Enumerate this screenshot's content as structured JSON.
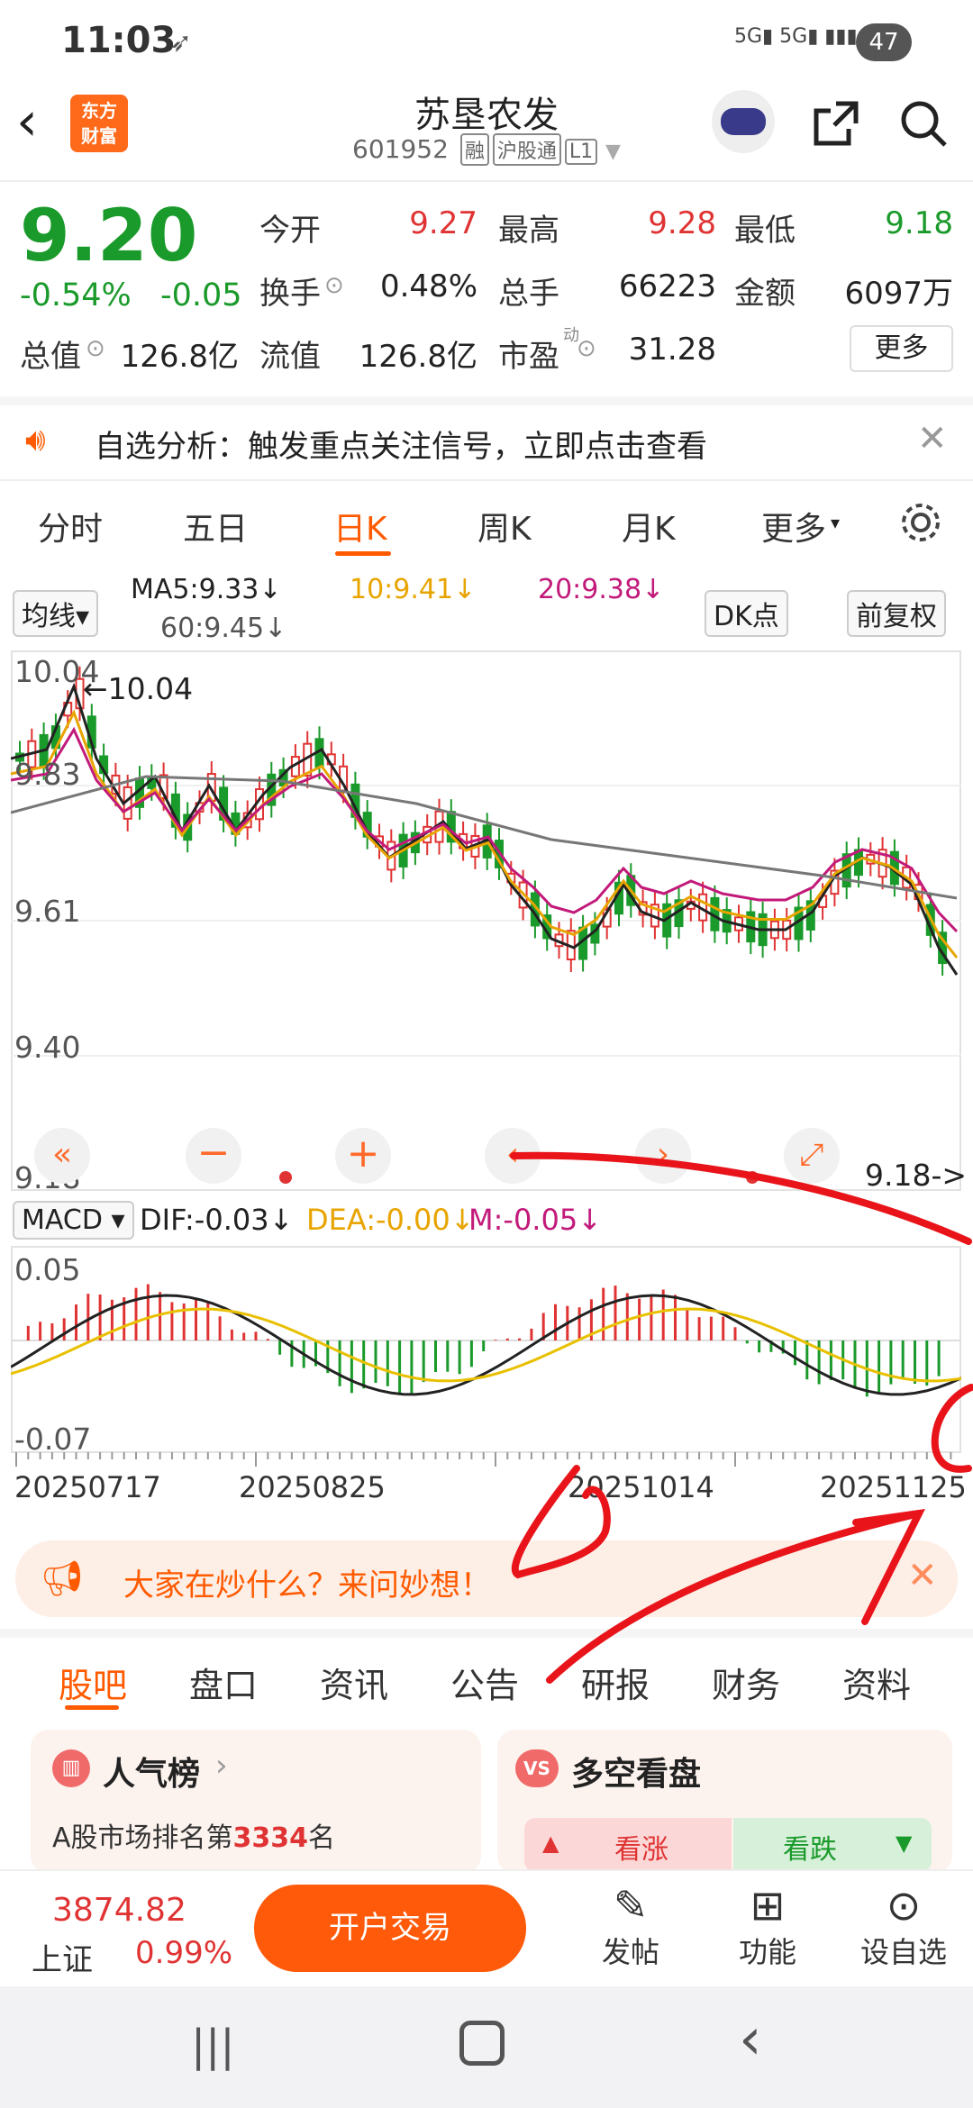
{
  "status": {
    "time": "11:03",
    "battery": "47"
  },
  "header": {
    "logo_line1": "东方",
    "logo_line2": "财富",
    "title": "苏垦农发",
    "code": "601952",
    "tags": [
      "融",
      "沪股通",
      "L1"
    ]
  },
  "quote": {
    "price": "9.20",
    "change_pct": "-0.54%",
    "change": "-0.05",
    "open_label": "今开",
    "open": "9.27",
    "high_label": "最高",
    "high": "9.28",
    "low_label": "最低",
    "low": "9.18",
    "turnover_label": "换手",
    "turnover": "0.48%",
    "volume_label": "总手",
    "volume": "66223",
    "amount_label": "金额",
    "amount": "6097万",
    "mcap_label": "总值",
    "mcap": "126.8亿",
    "float_label": "流值",
    "float_mcap": "126.8亿",
    "pe_label": "市盈",
    "pe_sup": "动",
    "pe": "31.28",
    "more": "更多"
  },
  "notice": {
    "text": "自选分析：触发重点关注信号，立即点击查看"
  },
  "tabs": [
    "分时",
    "五日",
    "日K",
    "周K",
    "月K",
    "更多"
  ],
  "ma": {
    "selector": "均线",
    "ma5": "MA5:9.33",
    "ma10": "10:9.41",
    "ma20": "20:9.38",
    "ma60": "60:9.45",
    "dk": "DK点",
    "adjust": "前复权"
  },
  "chart": {
    "y_labels": [
      "10.04",
      "9.83",
      "9.61",
      "9.40",
      "9.18"
    ],
    "max_label": "←10.04",
    "min_label": "9.18->"
  },
  "macd": {
    "selector": "MACD",
    "dif": "DIF:-0.03",
    "dea": "DEA:-0.00",
    "m": "M:-0.05",
    "y_top": "0.05",
    "y_bottom": "-0.07"
  },
  "dates": [
    "20250717",
    "20250825",
    "20251014",
    "20251125"
  ],
  "ask": {
    "text": "大家在炒什么？来问妙想！"
  },
  "bottom_tabs": [
    "股吧",
    "盘口",
    "资讯",
    "公告",
    "研报",
    "财务",
    "资料"
  ],
  "cards": {
    "rank_title": "人气榜",
    "rank_prefix": "A股市场排名第",
    "rank_num": "3334",
    "rank_suffix": "名",
    "vs_title": "多空看盘",
    "up": "看涨",
    "down": "看跌"
  },
  "footer": {
    "index_value": "3874.82",
    "index_name": "上证",
    "index_chg": "0.99%",
    "trade": "开户交易",
    "post": "发帖",
    "func": "功能",
    "watch": "设自选"
  },
  "colors": {
    "up": "#e03333",
    "down": "#1a9a2a",
    "accent": "#ff5a00"
  }
}
